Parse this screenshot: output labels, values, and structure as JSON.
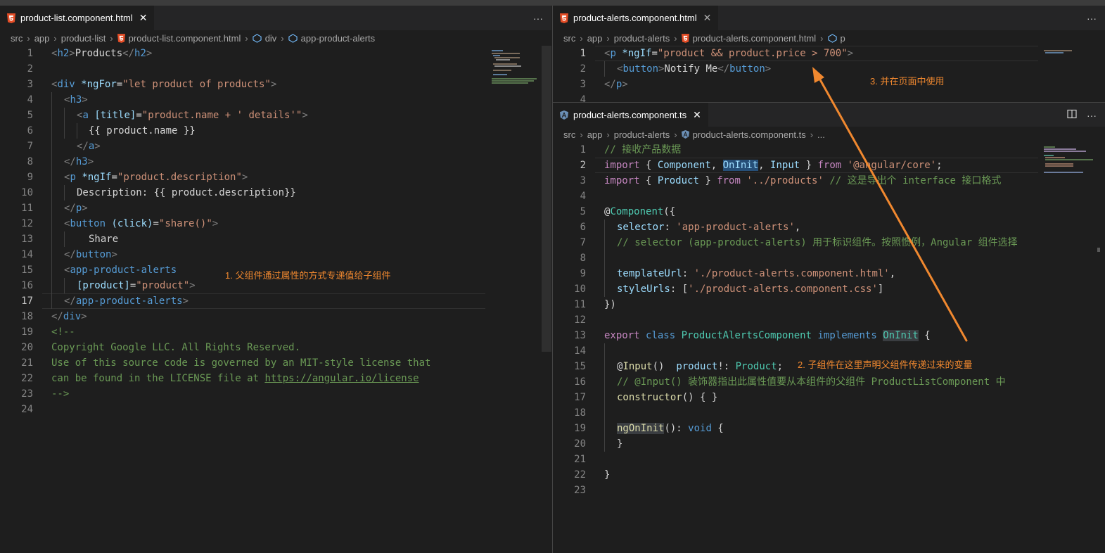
{
  "left": {
    "tab": {
      "label": "product-list.component.html",
      "icon": "html5-icon"
    },
    "actions": {
      "more": "···"
    },
    "breadcrumb": {
      "segments": [
        "src",
        "app",
        "product-list",
        "product-list.component.html",
        "div",
        "app-product-alerts"
      ]
    },
    "line_numbers": [
      "1",
      "2",
      "3",
      "4",
      "5",
      "6",
      "7",
      "8",
      "9",
      "10",
      "11",
      "12",
      "13",
      "14",
      "15",
      "16",
      "17",
      "18",
      "19",
      "20",
      "21",
      "22",
      "23",
      "24"
    ],
    "code": {
      "l1": [
        "<",
        "h2",
        ">",
        "Products",
        "</",
        "h2",
        ">"
      ],
      "l3": [
        "<",
        "div",
        " ",
        "*ngFor",
        "=",
        "\"let product of products\"",
        ">"
      ],
      "l4": [
        "<",
        "h3",
        ">"
      ],
      "l5": [
        "<",
        "a",
        " ",
        "[title]",
        "=",
        "\"product.name + ' details'\"",
        ">"
      ],
      "l6": "{{ product.name }}",
      "l7": [
        "</",
        "a",
        ">"
      ],
      "l8": [
        "</",
        "h3",
        ">"
      ],
      "l9": [
        "<",
        "p",
        " ",
        "*ngIf",
        "=",
        "\"product.description\"",
        ">"
      ],
      "l10": "Description: {{ product.description}}",
      "l11": [
        "</",
        "p",
        ">"
      ],
      "l12": [
        "<",
        "button",
        " ",
        "(click)",
        "=",
        "\"share()\"",
        ">"
      ],
      "l13": "Share",
      "l14": [
        "</",
        "button",
        ">"
      ],
      "l15": [
        "<",
        "app-product-alerts"
      ],
      "l16": [
        "[product]",
        "=",
        "\"product\"",
        ">"
      ],
      "l17": [
        "</",
        "app-product-alerts",
        ">"
      ],
      "l18": [
        "</",
        "div",
        ">"
      ],
      "l19": "<!--",
      "l20": "Copyright Google LLC. All Rights Reserved.",
      "l21": "Use of this source code is governed by an MIT-style license that",
      "l22a": "can be found in the LICENSE file at ",
      "l22b": "https://angular.io/license",
      "l23": "-->"
    },
    "annotation": "1. 父组件通过属性的方式专递值给子组件"
  },
  "right_top": {
    "tab": {
      "label": "product-alerts.component.html",
      "icon": "html5-icon"
    },
    "actions": {
      "more": "···"
    },
    "breadcrumb": {
      "segments": [
        "src",
        "app",
        "product-alerts",
        "product-alerts.component.html",
        "p"
      ]
    },
    "line_numbers": [
      "1",
      "2",
      "3",
      "4"
    ],
    "code": {
      "l1": [
        "<",
        "p",
        " ",
        "*ngIf",
        "=",
        "\"product && product.price > 700\"",
        ">"
      ],
      "l2": [
        "<",
        "button",
        ">",
        "Notify Me",
        "</",
        "button",
        ">"
      ],
      "l3": [
        "</",
        "p",
        ">"
      ]
    },
    "annotation": "3. 并在页面中使用"
  },
  "right_bottom": {
    "tab": {
      "label": "product-alerts.component.ts",
      "icon": "angular-icon"
    },
    "actions": {
      "split": "split-editor-icon",
      "more": "···"
    },
    "breadcrumb": {
      "segments": [
        "src",
        "app",
        "product-alerts",
        "product-alerts.component.ts",
        "..."
      ]
    },
    "line_numbers": [
      "1",
      "2",
      "3",
      "4",
      "5",
      "6",
      "7",
      "8",
      "9",
      "10",
      "11",
      "12",
      "13",
      "14",
      "15",
      "16",
      "17",
      "18",
      "19",
      "20",
      "21",
      "22",
      "23"
    ],
    "code": {
      "l1": "// 接收产品数据",
      "l2": [
        "import",
        " { ",
        "Component",
        ", ",
        "OnInit",
        ", ",
        "Input",
        " } ",
        "from",
        " ",
        "'@angular/core'",
        ";"
      ],
      "l3": [
        "import",
        " { ",
        "Product",
        " } ",
        "from",
        " ",
        "'../products'",
        " ",
        "// 这是导出个 interface 接口格式"
      ],
      "l5": [
        "@",
        "Component",
        "({"
      ],
      "l6": [
        "selector",
        ": ",
        "'app-product-alerts'",
        ","
      ],
      "l7": "// selector (app-product-alerts) 用于标识组件。按照惯例，Angular 组件选择",
      "l9": [
        "templateUrl",
        ": ",
        "'./product-alerts.component.html'",
        ","
      ],
      "l10": [
        "styleUrls",
        ": [",
        "'./product-alerts.component.css'",
        "]"
      ],
      "l11": "})",
      "l13": [
        "export",
        " ",
        "class",
        " ",
        "ProductAlertsComponent",
        " ",
        "implements",
        " ",
        "OnInit",
        " {"
      ],
      "l15": [
        "@",
        "Input",
        "()  ",
        "product",
        "!: ",
        "Product",
        ";"
      ],
      "l16": "// @Input() 装饰器指出此属性值要从本组件的父组件 ProductListComponent 中",
      "l17": [
        "constructor",
        "() { }"
      ],
      "l19": [
        "ngOnInit",
        "(): ",
        "void",
        " {"
      ],
      "l20": "}",
      "l22": "}"
    },
    "annotation": "2. 子组件在这里声明父组件传递过来的变量"
  },
  "colors": {
    "annotation": "#f0882f",
    "editor_bg": "#1e1e1e",
    "tabbar_bg": "#252526"
  }
}
